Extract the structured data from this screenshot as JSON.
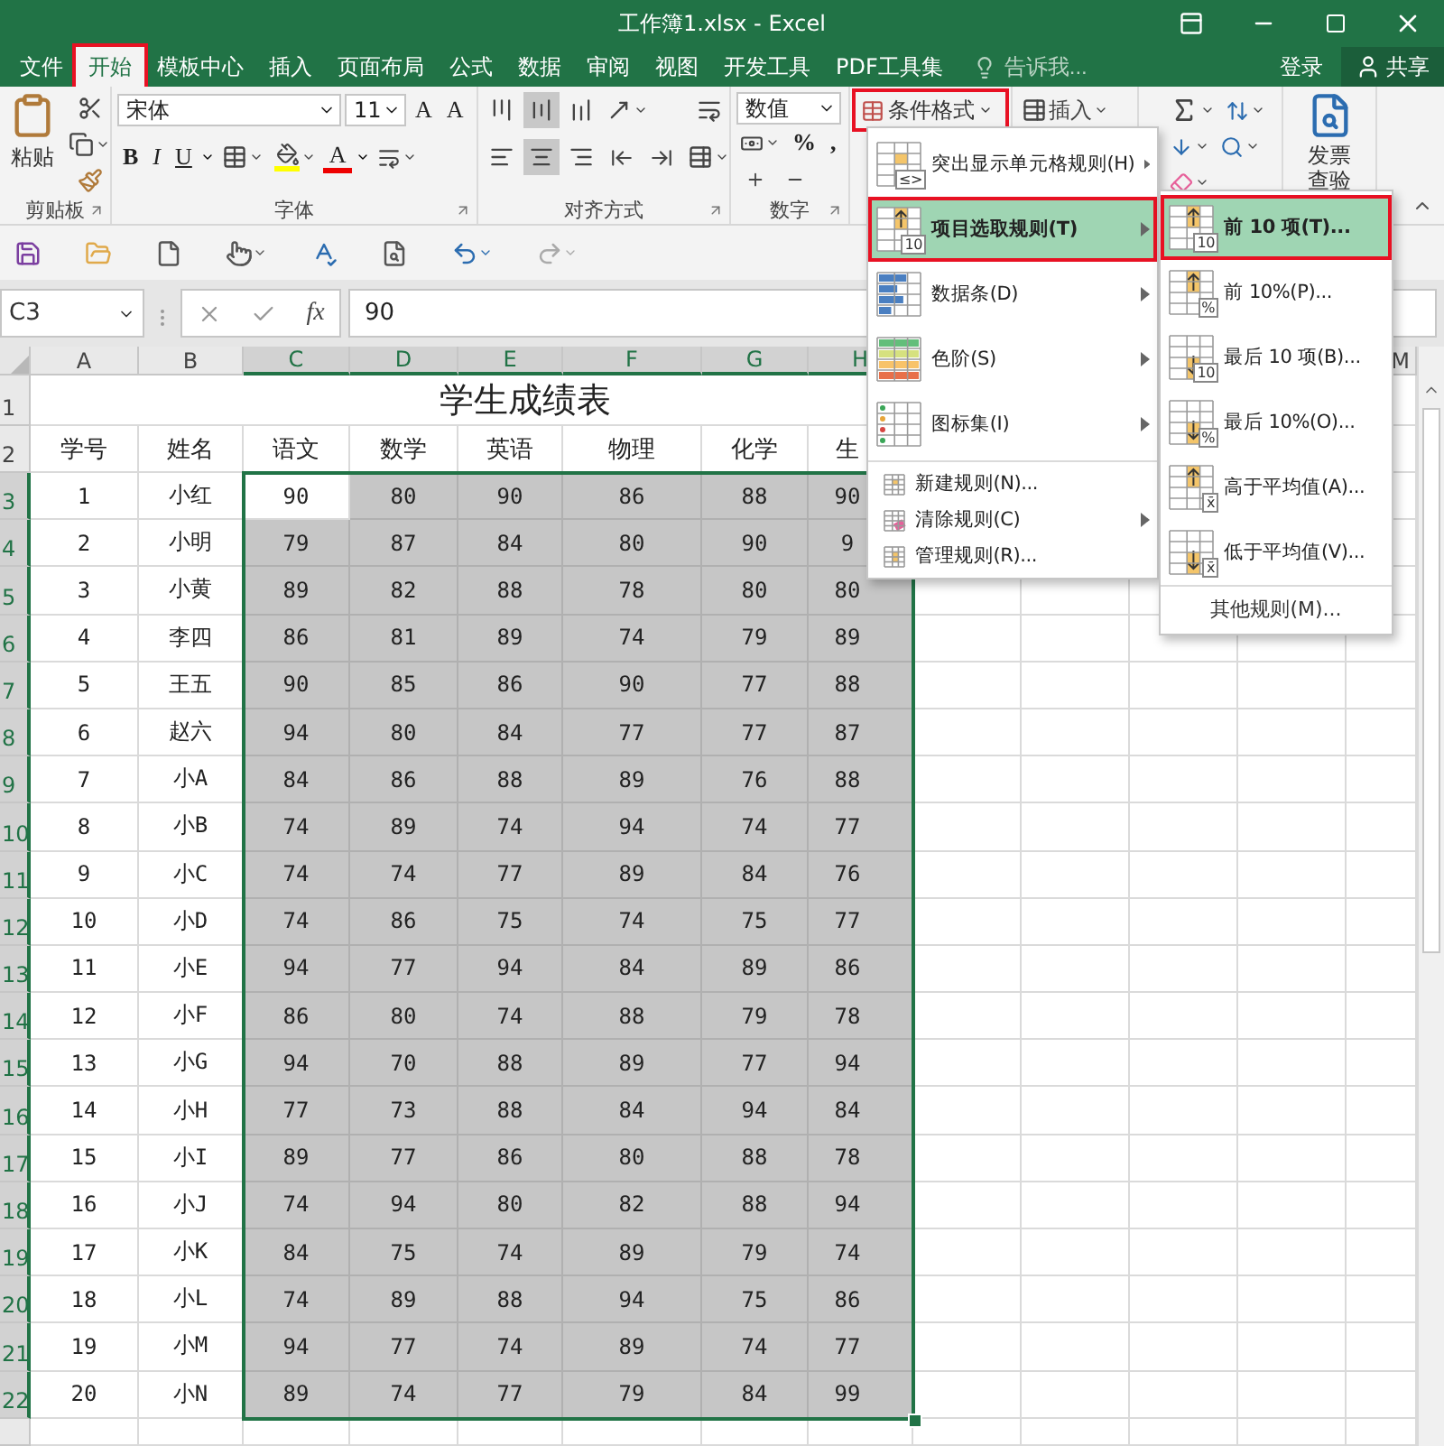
{
  "window": {
    "title": "工作簿1.xlsx - Excel"
  },
  "tabs": [
    {
      "label": "文件",
      "selected": false,
      "annotated": false
    },
    {
      "label": "开始",
      "selected": true,
      "annotated": true
    },
    {
      "label": "模板中心",
      "selected": false,
      "annotated": false
    },
    {
      "label": "插入",
      "selected": false,
      "annotated": false
    },
    {
      "label": "页面布局",
      "selected": false,
      "annotated": false
    },
    {
      "label": "公式",
      "selected": false,
      "annotated": false
    },
    {
      "label": "数据",
      "selected": false,
      "annotated": false
    },
    {
      "label": "审阅",
      "selected": false,
      "annotated": false
    },
    {
      "label": "视图",
      "selected": false,
      "annotated": false
    },
    {
      "label": "开发工具",
      "selected": false,
      "annotated": false
    },
    {
      "label": "PDF工具集",
      "selected": false,
      "annotated": false
    }
  ],
  "tell_me": {
    "placeholder": "告诉我..."
  },
  "account": {
    "sign_in": "登录",
    "share": "共享"
  },
  "ribbon": {
    "clipboard": {
      "paste": "粘贴",
      "label": "剪贴板"
    },
    "font": {
      "name": "宋体",
      "size": "11",
      "grow": "A",
      "shrink": "A",
      "bold": "B",
      "italic": "I",
      "underline": "U",
      "font_color_button": "A",
      "label": "字体"
    },
    "alignment": {
      "vertical": [
        {
          "kind": "top",
          "selected": false
        },
        {
          "kind": "middle",
          "selected": true
        },
        {
          "kind": "bottom",
          "selected": false
        }
      ],
      "horizontal": [
        {
          "kind": "left",
          "selected": false
        },
        {
          "kind": "center",
          "selected": true
        },
        {
          "kind": "right",
          "selected": false
        }
      ],
      "label": "对齐方式"
    },
    "number": {
      "format": "数值",
      "percent": "%",
      "comma": ",",
      "label": "数字"
    },
    "styles": {
      "conditional_format": "条件格式",
      "annotated": true
    },
    "cells": {
      "insert": "插入"
    },
    "invoice": "发票查验"
  },
  "formula_bar": {
    "name_box": "C3",
    "fx": "fx",
    "value": "90"
  },
  "sheet": {
    "columns": [
      {
        "label": "A",
        "selected": false
      },
      {
        "label": "B",
        "selected": false
      },
      {
        "label": "C",
        "selected": true
      },
      {
        "label": "D",
        "selected": true
      },
      {
        "label": "E",
        "selected": true
      },
      {
        "label": "F",
        "selected": true
      },
      {
        "label": "G",
        "selected": true
      },
      {
        "label": "H",
        "selected": true
      }
    ],
    "far_column": {
      "label": "M",
      "selected": false
    },
    "title_row": {
      "number": "1",
      "selected": false,
      "title": "学生成绩表"
    },
    "header_row": {
      "number": "2",
      "selected": false,
      "headers": [
        "学号",
        "姓名",
        "语文",
        "数学",
        "英语",
        "物理",
        "化学",
        "生"
      ]
    },
    "rows": [
      {
        "number": "3",
        "selected": true,
        "active": true,
        "id": "1",
        "name": "小红",
        "scores": [
          "90",
          "80",
          "90",
          "86",
          "88",
          "90"
        ]
      },
      {
        "number": "4",
        "selected": true,
        "active": false,
        "id": "2",
        "name": "小明",
        "scores": [
          "79",
          "87",
          "84",
          "80",
          "90",
          "9"
        ]
      },
      {
        "number": "5",
        "selected": true,
        "active": false,
        "id": "3",
        "name": "小黄",
        "scores": [
          "89",
          "82",
          "88",
          "78",
          "80",
          "80"
        ]
      },
      {
        "number": "6",
        "selected": true,
        "active": false,
        "id": "4",
        "name": "李四",
        "scores": [
          "86",
          "81",
          "89",
          "74",
          "79",
          "89"
        ]
      },
      {
        "number": "7",
        "selected": true,
        "active": false,
        "id": "5",
        "name": "王五",
        "scores": [
          "90",
          "85",
          "86",
          "90",
          "77",
          "88"
        ]
      },
      {
        "number": "8",
        "selected": true,
        "active": false,
        "id": "6",
        "name": "赵六",
        "scores": [
          "94",
          "80",
          "84",
          "77",
          "77",
          "87"
        ]
      },
      {
        "number": "9",
        "selected": true,
        "active": false,
        "id": "7",
        "name": "小A",
        "scores": [
          "84",
          "86",
          "88",
          "89",
          "76",
          "88"
        ]
      },
      {
        "number": "10",
        "selected": true,
        "active": false,
        "id": "8",
        "name": "小B",
        "scores": [
          "74",
          "89",
          "74",
          "94",
          "74",
          "77"
        ]
      },
      {
        "number": "11",
        "selected": true,
        "active": false,
        "id": "9",
        "name": "小C",
        "scores": [
          "74",
          "74",
          "77",
          "89",
          "84",
          "76"
        ]
      },
      {
        "number": "12",
        "selected": true,
        "active": false,
        "id": "10",
        "name": "小D",
        "scores": [
          "74",
          "86",
          "75",
          "74",
          "75",
          "77"
        ]
      },
      {
        "number": "13",
        "selected": true,
        "active": false,
        "id": "11",
        "name": "小E",
        "scores": [
          "94",
          "77",
          "94",
          "84",
          "89",
          "86"
        ]
      },
      {
        "number": "14",
        "selected": true,
        "active": false,
        "id": "12",
        "name": "小F",
        "scores": [
          "86",
          "80",
          "74",
          "88",
          "79",
          "78"
        ]
      },
      {
        "number": "15",
        "selected": true,
        "active": false,
        "id": "13",
        "name": "小G",
        "scores": [
          "94",
          "70",
          "88",
          "89",
          "77",
          "94"
        ]
      },
      {
        "number": "16",
        "selected": true,
        "active": false,
        "id": "14",
        "name": "小H",
        "scores": [
          "77",
          "73",
          "88",
          "84",
          "94",
          "84"
        ]
      },
      {
        "number": "17",
        "selected": true,
        "active": false,
        "id": "15",
        "name": "小I",
        "scores": [
          "89",
          "77",
          "86",
          "80",
          "88",
          "78"
        ]
      },
      {
        "number": "18",
        "selected": true,
        "active": false,
        "id": "16",
        "name": "小J",
        "scores": [
          "74",
          "94",
          "80",
          "82",
          "88",
          "94"
        ]
      },
      {
        "number": "19",
        "selected": true,
        "active": false,
        "id": "17",
        "name": "小K",
        "scores": [
          "84",
          "75",
          "74",
          "89",
          "79",
          "74"
        ]
      },
      {
        "number": "20",
        "selected": true,
        "active": false,
        "id": "18",
        "name": "小L",
        "scores": [
          "74",
          "89",
          "88",
          "94",
          "75",
          "86"
        ]
      },
      {
        "number": "21",
        "selected": true,
        "active": false,
        "id": "19",
        "name": "小M",
        "scores": [
          "94",
          "77",
          "74",
          "89",
          "74",
          "77"
        ]
      },
      {
        "number": "22",
        "selected": true,
        "active": false,
        "id": "20",
        "name": "小N",
        "scores": [
          "89",
          "74",
          "77",
          "79",
          "84",
          "99"
        ]
      }
    ]
  },
  "menu": {
    "items": [
      {
        "kind": "highlight",
        "label": "突出显示单元格规则(H)",
        "badge": "≤>",
        "submenu": true,
        "selected": false,
        "annotated": false
      },
      {
        "kind": "top",
        "label": "项目选取规则(T)",
        "badge": "10",
        "submenu": true,
        "selected": true,
        "annotated": true
      },
      {
        "kind": "databar",
        "label": "数据条(D)",
        "submenu": true,
        "selected": false,
        "annotated": false
      },
      {
        "kind": "colorscale",
        "label": "色阶(S)",
        "submenu": true,
        "selected": false,
        "annotated": false
      },
      {
        "kind": "iconset",
        "label": "图标集(I)",
        "submenu": true,
        "selected": false,
        "annotated": false
      },
      {
        "kind": "new",
        "label": "新建规则(N)...",
        "submenu": false,
        "selected": false,
        "annotated": false
      },
      {
        "kind": "clear",
        "label": "清除规则(C)",
        "submenu": true,
        "selected": false,
        "annotated": false
      },
      {
        "kind": "manage",
        "label": "管理规则(R)...",
        "submenu": false,
        "selected": false,
        "annotated": false
      }
    ]
  },
  "submenu": {
    "items": [
      {
        "kind": "up",
        "label": "前 10 项(T)...",
        "badge": "10",
        "selected": true,
        "annotated": true
      },
      {
        "kind": "up",
        "label": "前 10%(P)...",
        "badge": "%",
        "selected": false,
        "annotated": false
      },
      {
        "kind": "down",
        "label": "最后 10 项(B)...",
        "badge": "10",
        "selected": false,
        "annotated": false
      },
      {
        "kind": "down",
        "label": "最后 10%(O)...",
        "badge": "%",
        "selected": false,
        "annotated": false
      },
      {
        "kind": "up",
        "label": "高于平均值(A)...",
        "badge": "x̄",
        "selected": false,
        "annotated": false
      },
      {
        "kind": "down",
        "label": "低于平均值(V)...",
        "badge": "x̄",
        "selected": false,
        "annotated": false
      }
    ],
    "more": "其他规则(M)..."
  }
}
